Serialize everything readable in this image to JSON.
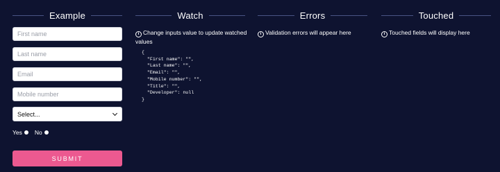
{
  "columns": {
    "example": {
      "title": "Example"
    },
    "watch": {
      "title": "Watch",
      "info": "Change inputs value to update watched values",
      "json_lines": [
        "{",
        "  \"First name\": \"\",",
        "  \"Last name\": \"\",",
        "  \"Email\": \"\",",
        "  \"Mobile number\": \"\",",
        "  \"Title\": \"\",",
        "  \"Developer\": null",
        "}"
      ]
    },
    "errors": {
      "title": "Errors",
      "info": "Validation errors will appear here"
    },
    "touched": {
      "title": "Touched",
      "info": "Touched fields will display here"
    }
  },
  "form": {
    "first_name_placeholder": "First name",
    "last_name_placeholder": "Last name",
    "email_placeholder": "Email",
    "mobile_placeholder": "Mobile number",
    "select_value": "Select...",
    "radio_yes": "Yes",
    "radio_no": "No",
    "submit_label": "SUBMIT"
  },
  "colors": {
    "background": "#0e1330",
    "accent_button": "#ec5990",
    "heading_line": "#4a5584"
  },
  "icons": {
    "info": "info-circle-icon",
    "select_chevron": "chevron-down-icon"
  }
}
